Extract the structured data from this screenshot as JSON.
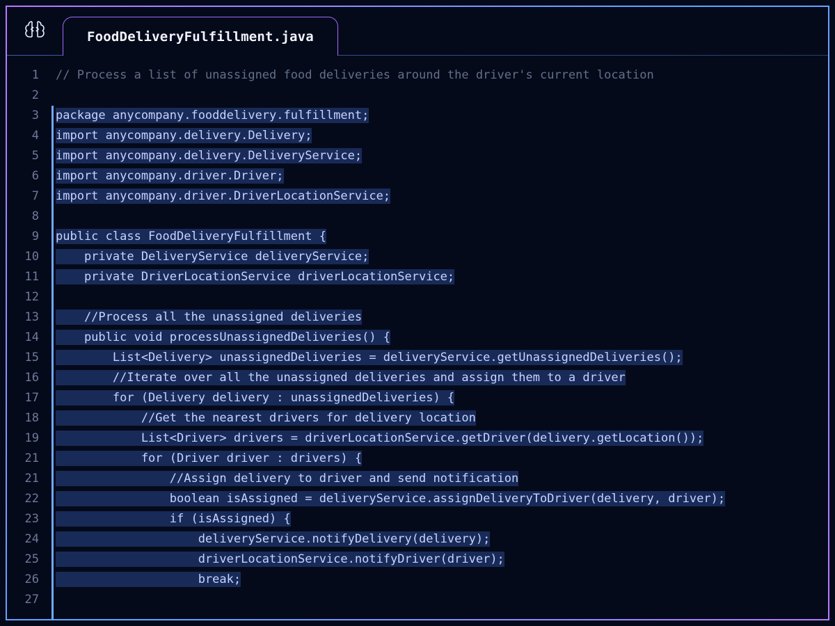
{
  "tab": {
    "filename": "FoodDeliveryFulfillment.java"
  },
  "gutter": [
    "1",
    "2",
    "3",
    "4",
    "5",
    "6",
    "7",
    "8",
    "9",
    "10",
    "11",
    "12",
    "13",
    "14",
    "15",
    "16",
    "17",
    "18",
    "19",
    "21",
    "21",
    "22",
    "23",
    "24",
    "25",
    "26",
    "27"
  ],
  "code": {
    "l1": "// Process a list of unassigned food deliveries around the driver's current location",
    "l2": "",
    "l3": "package anycompany.fooddelivery.fulfillment;",
    "l4": "import anycompany.delivery.Delivery;",
    "l5": "import anycompany.delivery.DeliveryService;",
    "l6": "import anycompany.driver.Driver;",
    "l7": "import anycompany.driver.DriverLocationService;",
    "l8": "",
    "l9": "public class FoodDeliveryFulfillment {",
    "l10": "    private DeliveryService deliveryService;",
    "l11": "    private DriverLocationService driverLocationService;",
    "l12": "",
    "l13": "    //Process all the unassigned deliveries",
    "l14": "    public void processUnassignedDeliveries() {",
    "l15": "        List<Delivery> unassignedDeliveries = deliveryService.getUnassignedDeliveries();",
    "l16": "        //Iterate over all the unassigned deliveries and assign them to a driver",
    "l17": "        for (Delivery delivery : unassignedDeliveries) {",
    "l18": "            //Get the nearest drivers for delivery location",
    "l19": "            List<Driver> drivers = driverLocationService.getDriver(delivery.getLocation());",
    "l20": "            for (Driver driver : drivers) {",
    "l21": "                //Assign delivery to driver and send notification",
    "l22": "                boolean isAssigned = deliveryService.assignDeliveryToDriver(delivery, driver);",
    "l23": "                if (isAssigned) {",
    "l24": "                    deliveryService.notifyDelivery(delivery);",
    "l25": "                    driverLocationService.notifyDriver(driver);",
    "l26": "                    break;"
  },
  "colors": {
    "accent_purple": "#a06cff",
    "accent_blue": "#6fa8ff",
    "bg": "#050a1a",
    "highlight": "rgba(40,70,140,0.55)"
  }
}
